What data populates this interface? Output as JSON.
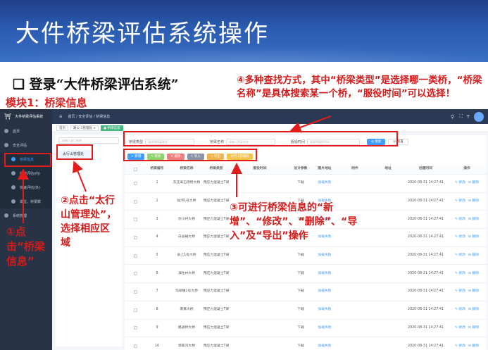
{
  "slide_title": "大件桥梁评估系统操作",
  "subtitle": "❑ 登录“大件桥梁评估系统”",
  "module_label": "模块1：桥梁信息",
  "notes": {
    "n1": "①点击“桥梁信息”",
    "n2": "②点击“太行山管理处”，选择相应区域",
    "n3": "③可进行桥梁信息的“新增”、“修改”、“删除”、“导入”及“导出”操作",
    "n4": "④多种查找方式，其中“桥梁类型”是选择哪一类桥，“桥梁名称”是具体搜索某一个桥，“服役时间”可以选择！"
  },
  "app": {
    "name": "大件桥梁评估系统",
    "breadcrumb": "首页 / 安全评估 / 桥梁信息",
    "tags": [
      "首页",
      "路公-1管理处 ×",
      "● 桥梁信息"
    ],
    "sidebar": [
      "首页",
      "安全评估",
      "桥梁信息",
      "快速评估(内)",
      "快速评估(外)",
      "单位、桥梁数",
      "系统管理"
    ],
    "tree_search_placeholder": "请输入部门名称",
    "tree_node": "太行山管理处",
    "filter": {
      "type_label": "桥梁类型",
      "type_placeholder": "请选择桥梁类型",
      "name_label": "桥梁名称",
      "name_placeholder": "请输入桥梁名称",
      "time_label": "服役时间",
      "time_placeholder": "请选择服役时间",
      "search": "◎ 搜索",
      "reset": "◎ 重置"
    },
    "actions": [
      "+ 新增",
      "✎ 修改",
      "✕ 删除",
      "⇧ 导入",
      "⇩ 导出",
      "太行山管理处"
    ],
    "columns": [
      "桥梁编号",
      "桥梁名称",
      "桥梁类型",
      "服役时间",
      "设计参数",
      "图片地址",
      "附件",
      "地址",
      "创建时间",
      "操作"
    ],
    "rows": [
      [
        "1",
        "东庄采石场特大桥",
        "预应力混凝土T梁",
        "下载",
        "2020-08-31 14:27:41"
      ],
      [
        "2",
        "加河1号大桥",
        "预应力混凝土T梁",
        "下载",
        "2020-08-31 14:27:41"
      ],
      [
        "3",
        "坎川村大桥",
        "预应力混凝土T梁",
        "下载",
        "2020-08-31 14:27:41"
      ],
      [
        "4",
        "白谷峪大桥",
        "预应力混凝土T梁",
        "下载",
        "2020-08-31 14:27:41"
      ],
      [
        "5",
        "泉上1号大桥",
        "预应力混凝土T梁",
        "下载",
        "2020-08-31 14:27:41"
      ],
      [
        "6",
        "漳往村大桥",
        "预应力混凝土T梁",
        "下载",
        "2020-08-31 14:27:41"
      ],
      [
        "7",
        "玛翠嘴1号大桥",
        "预应力混凝土T梁",
        "下载",
        "2020-08-31 14:27:41"
      ],
      [
        "8",
        "南寨大桥",
        "预应力混凝土T梁",
        "下载",
        "2020-08-31 14:27:41"
      ],
      [
        "9",
        "路通桥大桥",
        "预应力混凝土T梁",
        "下载",
        "2020-08-31 14:27:41"
      ],
      [
        "10",
        "郭家沟大桥",
        "预应力混凝土T梁",
        "下载",
        "2020-08-31 14:27:41"
      ]
    ],
    "image_cell": "加载失败",
    "edit": "✎ 修改",
    "delete": "⊟ 删除"
  },
  "colors": {
    "annotation": "#e31b1b",
    "banner": "#2a5bb0",
    "sidebar": "#283446",
    "primary": "#409eff"
  }
}
